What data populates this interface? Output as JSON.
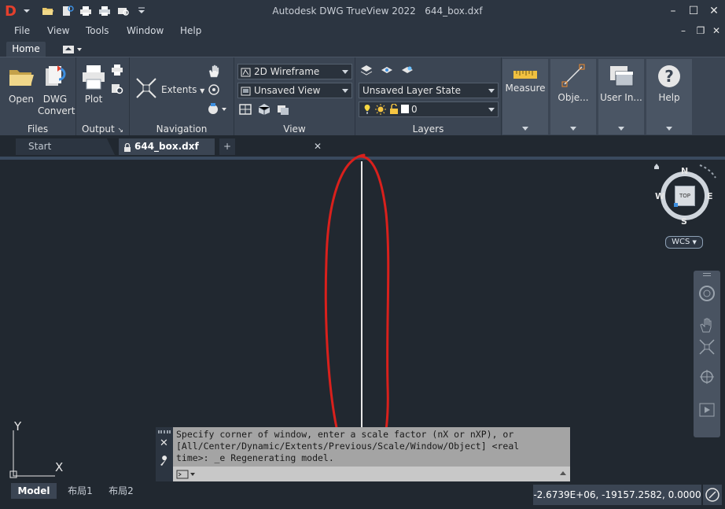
{
  "app": {
    "title": "Autodesk DWG TrueView 2022",
    "file_name": "644_box.dxf",
    "logo": "D"
  },
  "quick_access": [
    {
      "icon": "open-folder-icon"
    },
    {
      "icon": "dwg-convert-icon"
    },
    {
      "icon": "plot-icon"
    },
    {
      "icon": "batch-plot-icon"
    },
    {
      "icon": "preview-icon"
    },
    {
      "icon": "customize-dropdown-icon"
    }
  ],
  "menu": [
    "File",
    "View",
    "Tools",
    "Window",
    "Help"
  ],
  "ribbon": {
    "tabs": [
      "Home"
    ],
    "panels": {
      "files": {
        "title": "Files",
        "open": "Open",
        "dwg_convert_1": "DWG",
        "dwg_convert_2": "Convert"
      },
      "output": {
        "title": "Output",
        "plot": "Plot",
        "expander": "↘"
      },
      "navigation": {
        "title": "Navigation",
        "extents": "Extents"
      },
      "view": {
        "title": "View",
        "visual_style": "2D Wireframe",
        "named_view": "Unsaved View"
      },
      "layers": {
        "title": "Layers",
        "layer_state": "Unsaved Layer State",
        "layer_name": "0"
      },
      "measure": "Measure",
      "objects": "Obje...",
      "user_interface": "User In...",
      "help": "Help"
    }
  },
  "doc_tabs": {
    "start": "Start",
    "active": "644_box.dxf",
    "close": "✕",
    "new": "+"
  },
  "viewcube": {
    "north": "N",
    "south": "S",
    "east": "E",
    "west": "W",
    "face": "TOP",
    "wcs": "WCS"
  },
  "ucs": {
    "x": "X",
    "y": "Y"
  },
  "command_line": {
    "history_1": "Specify corner of window, enter a scale factor (nX or nXP), or",
    "history_2": "[All/Center/Dynamic/Extents/Previous/Scale/Window/Object] <real",
    "history_3": "time>: _e Regenerating model.",
    "input_value": "",
    "input_placeholder": ""
  },
  "layout_tabs": [
    "Model",
    "布局1",
    "布局2"
  ],
  "coordinates": "-2.6739E+06, -19157.2582, 0.0000",
  "colors": {
    "canvas": "#212830",
    "ribbon": "#3b4553",
    "annotation": "#d9201c",
    "drawn_line": "#e8e8e8",
    "logo": "#e4402d"
  }
}
